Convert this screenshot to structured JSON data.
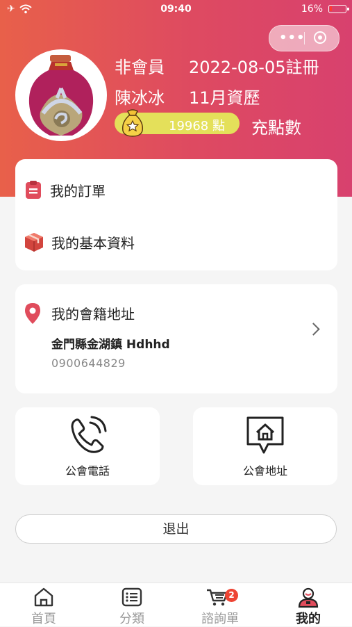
{
  "status_bar": {
    "time": "09:40",
    "battery": "16%",
    "battery_level": 0.16
  },
  "profile": {
    "member_type": "非會員",
    "register_date": "2022-08-05註冊",
    "name": "陳冰冰",
    "seniority": "11月資歷",
    "points": "19968 點",
    "recharge_label": "充點數"
  },
  "menu": {
    "orders_label": "我的訂單",
    "basic_info_label": "我的基本資料"
  },
  "address": {
    "title": "我的會籍地址",
    "line": "金門縣金湖鎮 Hdhhd",
    "phone": "0900644829"
  },
  "tiles": {
    "phone_label": "公會電話",
    "address_label": "公會地址"
  },
  "logout_label": "退出",
  "tabbar": {
    "home": "首頁",
    "category": "分類",
    "inquiry": "諮詢單",
    "inquiry_badge": "2",
    "mine": "我的"
  },
  "colors": {
    "header_start": "#e8604a",
    "header_end": "#d8416e",
    "accent": "#e04c5c",
    "points_pill": "#e4e05a"
  }
}
